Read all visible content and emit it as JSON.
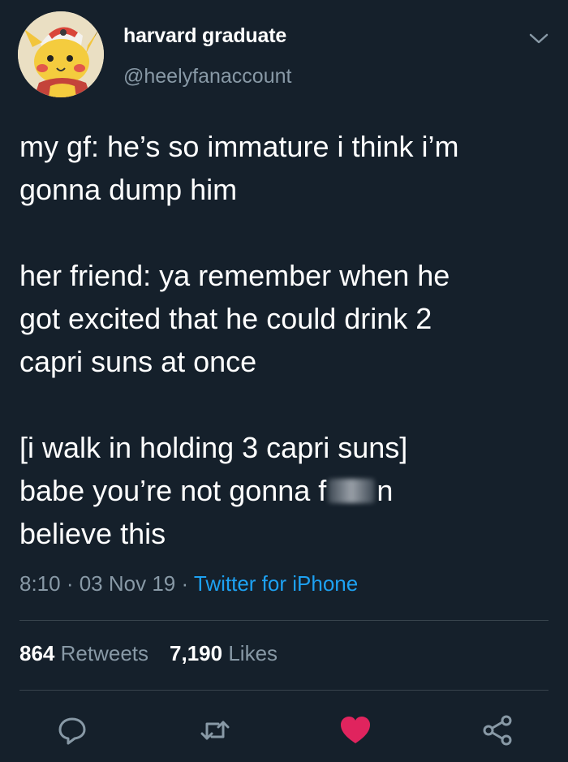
{
  "user": {
    "display_name": "harvard graduate",
    "handle": "@heelyfanaccount"
  },
  "tweet": {
    "line1": "my gf: he’s so immature i think i’m",
    "line2": "gonna dump him",
    "line3": "her friend: ya remember when he",
    "line4": "got excited that he could drink 2",
    "line5": "capri suns at once",
    "line6": "[i walk in holding 3 capri suns]",
    "line7_before": "babe you’re not gonna f",
    "line7_after": "n",
    "line8": "believe this"
  },
  "meta": {
    "time": "8:10",
    "separator": " · ",
    "date": "03 Nov 19",
    "source": "Twitter for iPhone"
  },
  "stats": {
    "retweets_count": "864",
    "retweets_label": "Retweets",
    "likes_count": "7,190",
    "likes_label": "Likes"
  },
  "colors": {
    "background": "#15202b",
    "secondary_text": "#8899a6",
    "link": "#1da1f2",
    "like": "#e0245e",
    "divider": "#38444d"
  },
  "icons": {
    "reply": "reply-icon",
    "retweet": "retweet-icon",
    "like": "heart-icon",
    "share": "share-icon",
    "caret": "chevron-down-icon"
  }
}
